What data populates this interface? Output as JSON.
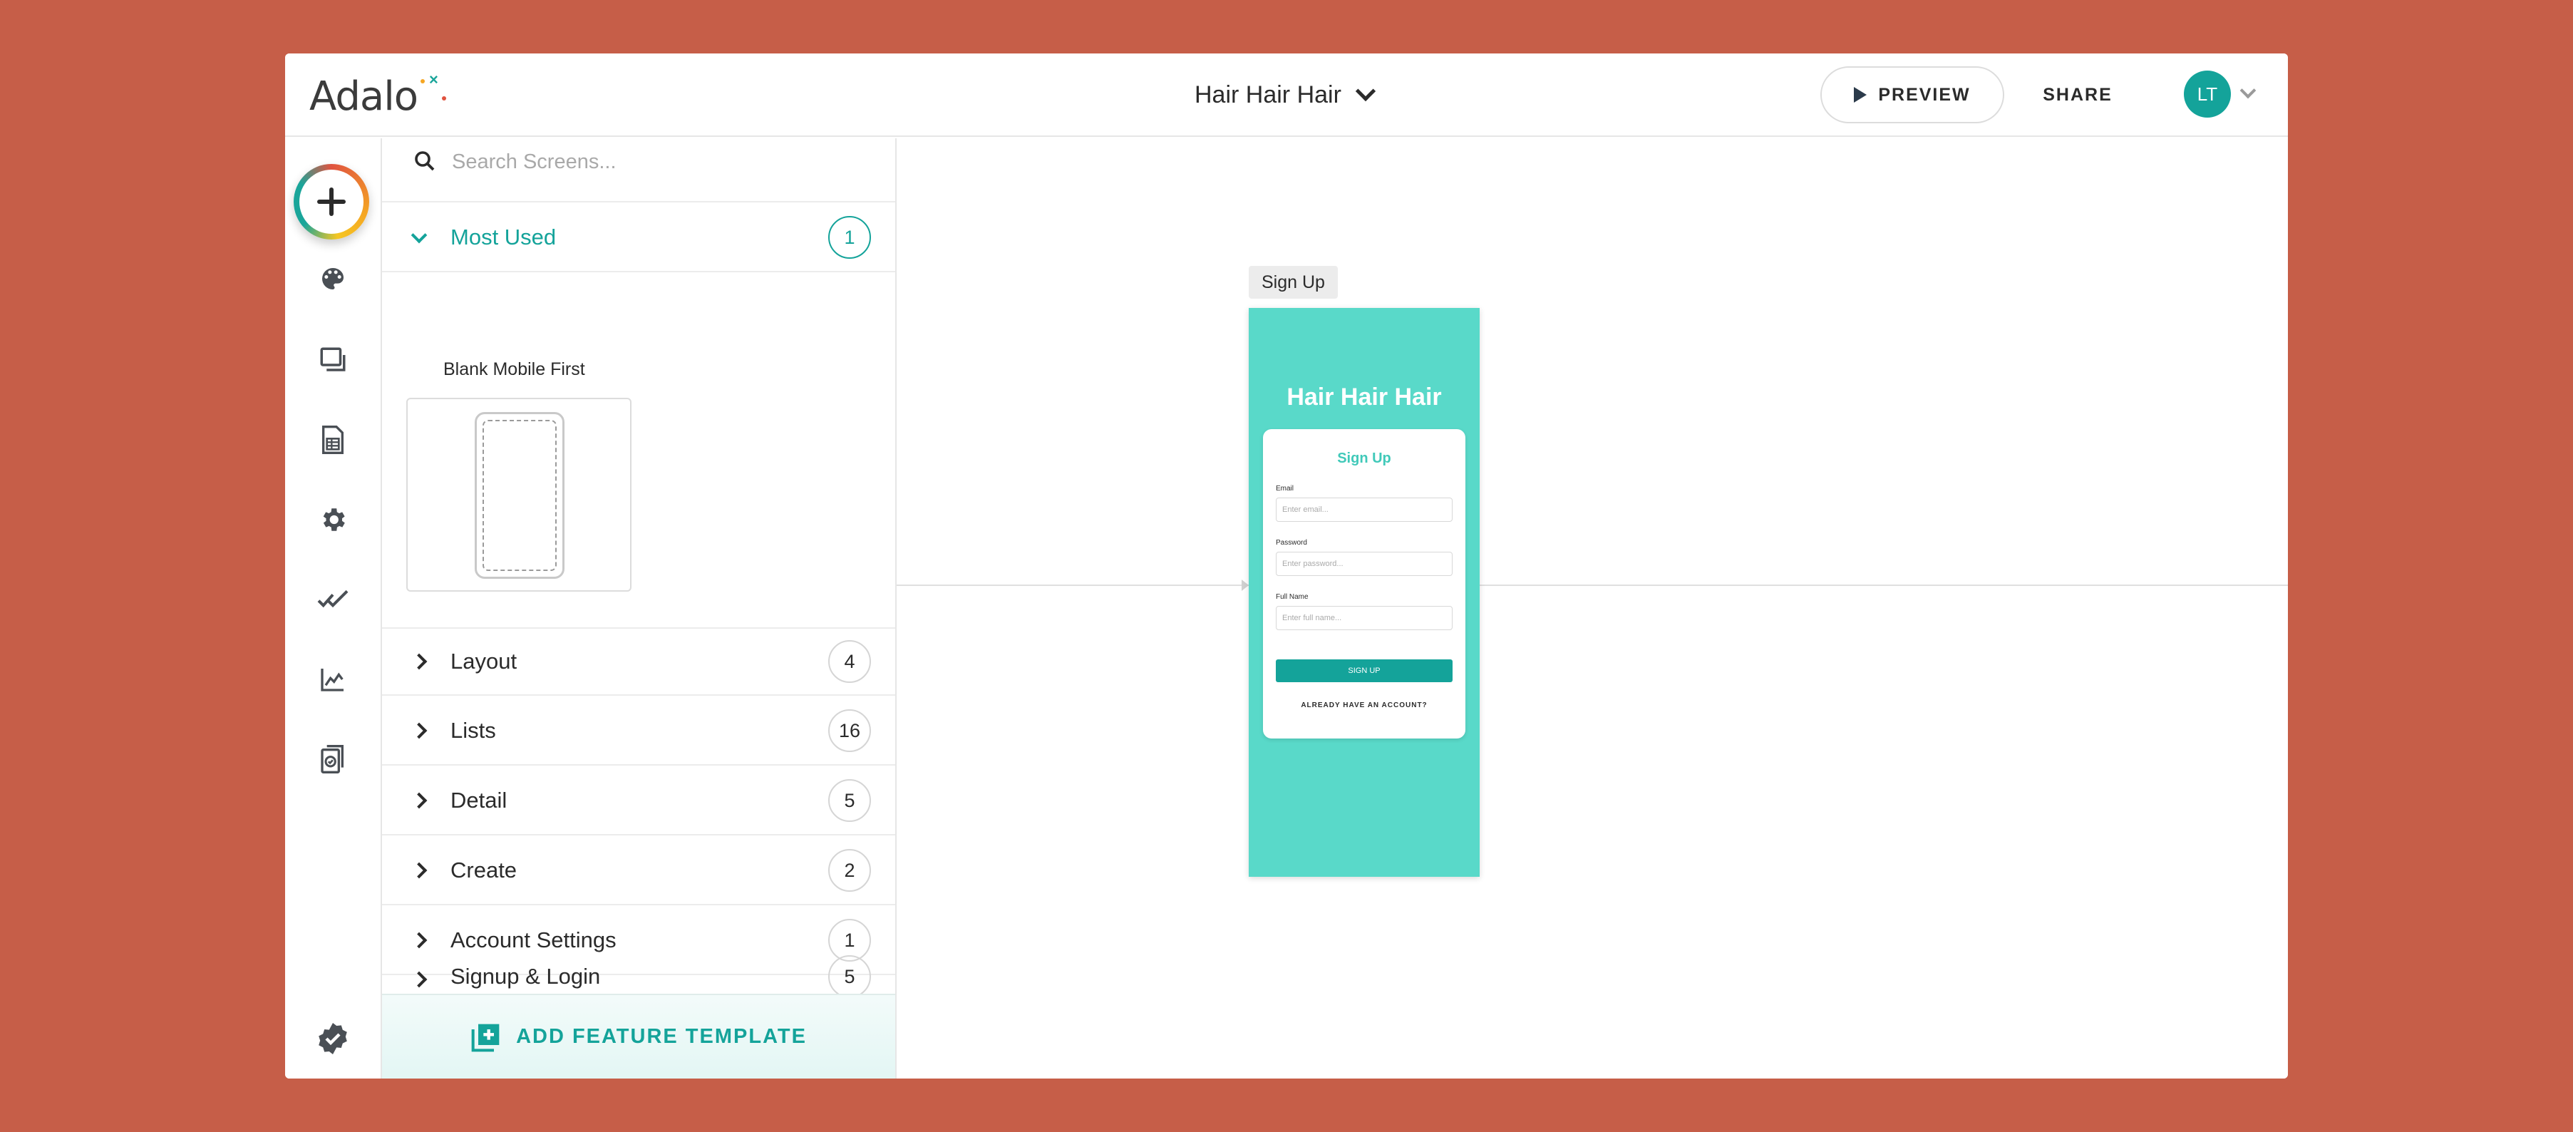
{
  "brand": {
    "name": "Adalo",
    "accent": "#14a39a",
    "background": "#c65e48"
  },
  "header": {
    "project_title": "Hair Hair Hair",
    "preview_label": "PREVIEW",
    "share_label": "SHARE",
    "avatar_initials": "LT"
  },
  "rail": {
    "items": [
      "add-icon",
      "palette-icon",
      "screens-icon",
      "database-icon",
      "settings-icon",
      "publish-icon",
      "analytics-icon",
      "branding-icon",
      "verified-icon"
    ]
  },
  "panel": {
    "search_placeholder": "Search Screens...",
    "groups": [
      {
        "label": "Most Used",
        "count": "1",
        "expanded": true
      },
      {
        "label": "Layout",
        "count": "4"
      },
      {
        "label": "Lists",
        "count": "16"
      },
      {
        "label": "Detail",
        "count": "5"
      },
      {
        "label": "Create",
        "count": "2"
      },
      {
        "label": "Account Settings",
        "count": "1"
      },
      {
        "label": "Signup & Login",
        "count": "5"
      }
    ],
    "template_label": "Blank Mobile First",
    "feature_template_label": "ADD FEATURE TEMPLATE"
  },
  "canvas": {
    "screen_tag": "Sign Up",
    "screen": {
      "app_title": "Hair Hair Hair",
      "card_title": "Sign Up",
      "fields": [
        {
          "label": "Email",
          "placeholder": "Enter email..."
        },
        {
          "label": "Password",
          "placeholder": "Enter password..."
        },
        {
          "label": "Full Name",
          "placeholder": "Enter full name..."
        }
      ],
      "button_label": "SIGN UP",
      "link_label": "ALREADY HAVE AN ACCOUNT?",
      "color": "#59d9c9"
    }
  }
}
